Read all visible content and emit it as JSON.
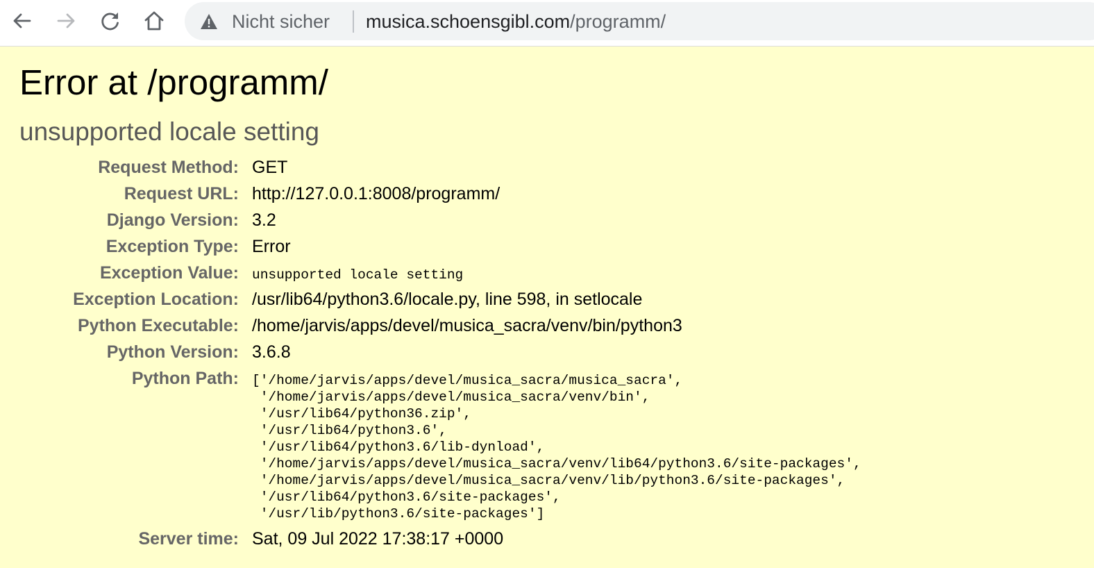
{
  "browser": {
    "security_label": "Nicht sicher",
    "url_host": "musica.schoensgibl.com",
    "url_path": "/programm/",
    "icons": [
      "back-arrow-icon",
      "forward-arrow-icon",
      "reload-icon",
      "home-icon",
      "warning-icon"
    ],
    "colors": {
      "security_text": "#5f6368",
      "omnibox_bg": "#f1f3f4"
    }
  },
  "error": {
    "title": "Error at /programm/",
    "message": "unsupported locale setting",
    "colors": {
      "background": "#ffffcc",
      "label": "#666666",
      "subtitle": "#575757"
    },
    "meta": {
      "request_method": {
        "label": "Request Method:",
        "value": "GET"
      },
      "request_url": {
        "label": "Request URL:",
        "value": "http://127.0.0.1:8008/programm/"
      },
      "django_version": {
        "label": "Django Version:",
        "value": "3.2"
      },
      "exception_type": {
        "label": "Exception Type:",
        "value": "Error"
      },
      "exception_value": {
        "label": "Exception Value:",
        "value": "unsupported locale setting"
      },
      "exception_location": {
        "label": "Exception Location:",
        "value": "/usr/lib64/python3.6/locale.py, line 598, in setlocale"
      },
      "python_executable": {
        "label": "Python Executable:",
        "value": "/home/jarvis/apps/devel/musica_sacra/venv/bin/python3"
      },
      "python_version": {
        "label": "Python Version:",
        "value": "3.6.8"
      },
      "python_path": {
        "label": "Python Path:",
        "value": "['/home/jarvis/apps/devel/musica_sacra/musica_sacra',\n '/home/jarvis/apps/devel/musica_sacra/venv/bin',\n '/usr/lib64/python36.zip',\n '/usr/lib64/python3.6',\n '/usr/lib64/python3.6/lib-dynload',\n '/home/jarvis/apps/devel/musica_sacra/venv/lib64/python3.6/site-packages',\n '/home/jarvis/apps/devel/musica_sacra/venv/lib/python3.6/site-packages',\n '/usr/lib64/python3.6/site-packages',\n '/usr/lib/python3.6/site-packages']"
      },
      "server_time": {
        "label": "Server time:",
        "value": "Sat, 09 Jul 2022 17:38:17 +0000"
      }
    }
  }
}
